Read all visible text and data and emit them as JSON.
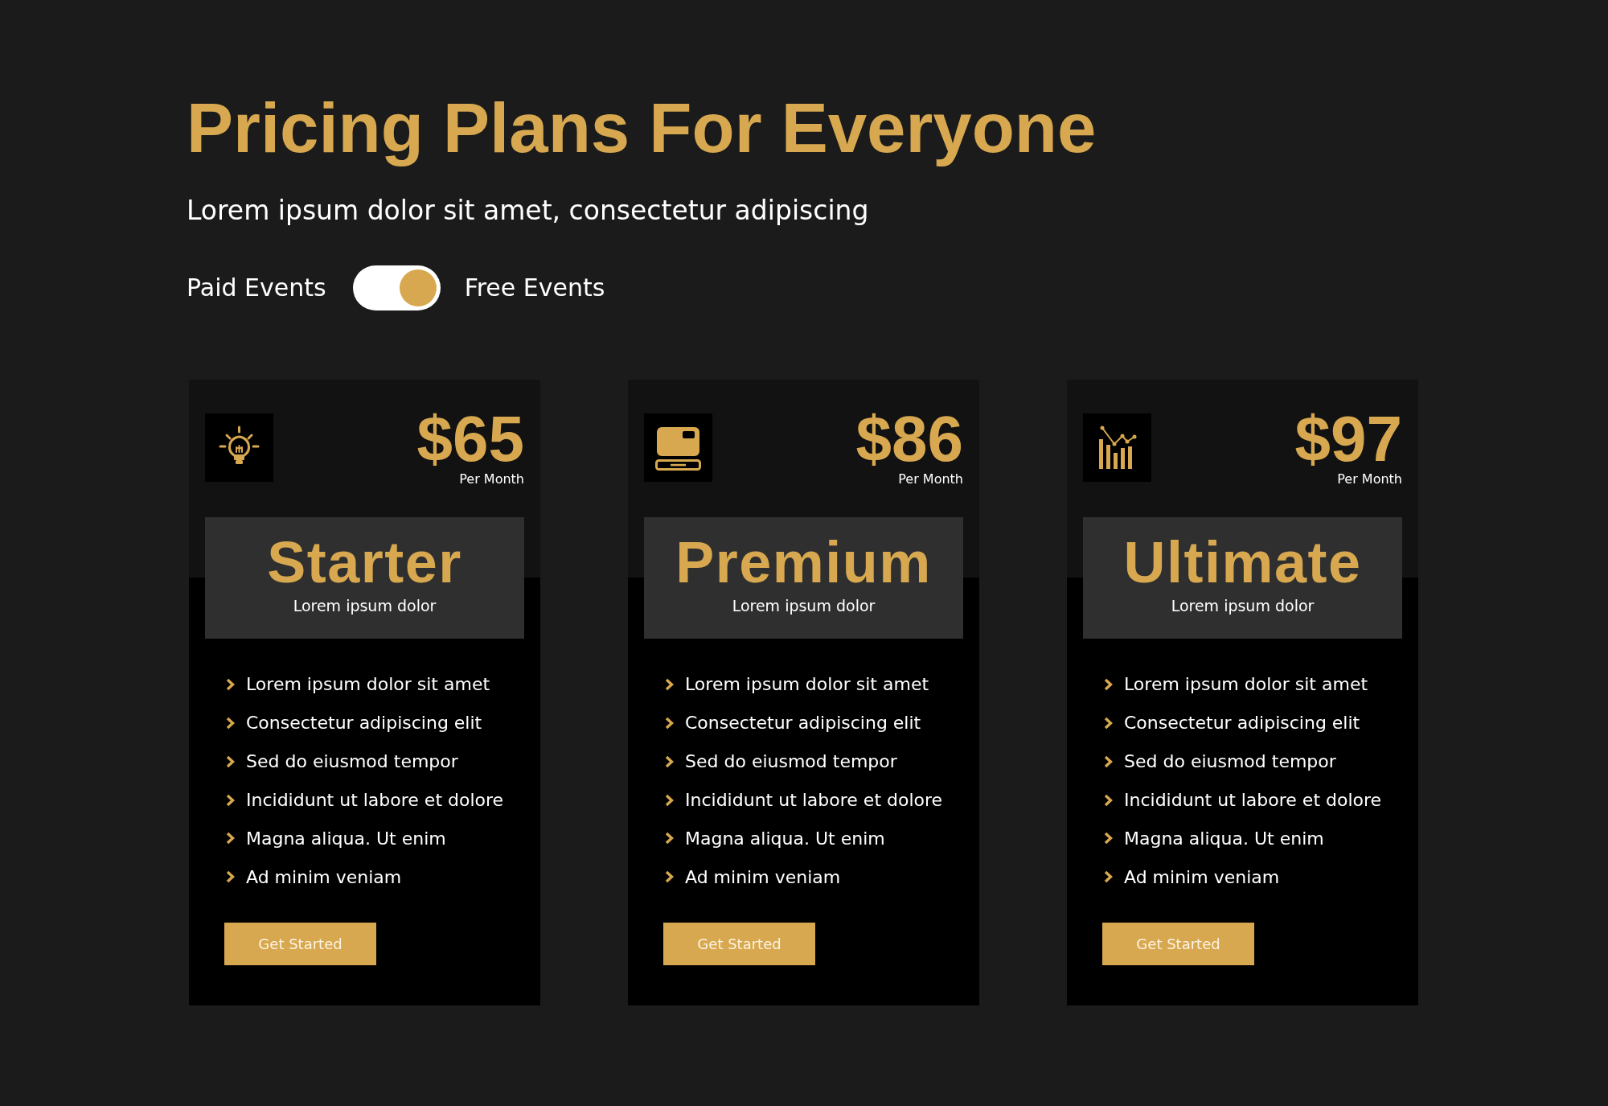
{
  "title": "Pricing Plans For Everyone",
  "subtitle": "Lorem ipsum dolor sit amet, consectetur adipiscing",
  "toggle": {
    "left_label": "Paid Events",
    "right_label": "Free Events",
    "on": true
  },
  "plans": [
    {
      "price": "$65",
      "period": "Per Month",
      "name": "Starter",
      "tagline": "Lorem ipsum dolor",
      "features": [
        "Lorem ipsum dolor sit amet",
        "Consectetur adipiscing elit",
        "Sed do eiusmod tempor",
        "Incididunt ut labore et dolore",
        "Magna aliqua. Ut enim",
        "Ad minim veniam"
      ],
      "button": "Get Started"
    },
    {
      "price": "$86",
      "period": "Per Month",
      "name": "Premium",
      "tagline": "Lorem ipsum dolor",
      "features": [
        "Lorem ipsum dolor sit amet",
        "Consectetur adipiscing elit",
        "Sed do eiusmod tempor",
        "Incididunt ut labore et dolore",
        "Magna aliqua. Ut enim",
        "Ad minim veniam"
      ],
      "button": "Get Started"
    },
    {
      "price": "$97",
      "period": "Per Month",
      "name": "Ultimate",
      "tagline": "Lorem ipsum dolor",
      "features": [
        "Lorem ipsum dolor sit amet",
        "Consectetur adipiscing elit",
        "Sed do eiusmod tempor",
        "Incididunt ut labore et dolore",
        "Magna aliqua. Ut enim",
        "Ad minim veniam"
      ],
      "button": "Get Started"
    }
  ]
}
